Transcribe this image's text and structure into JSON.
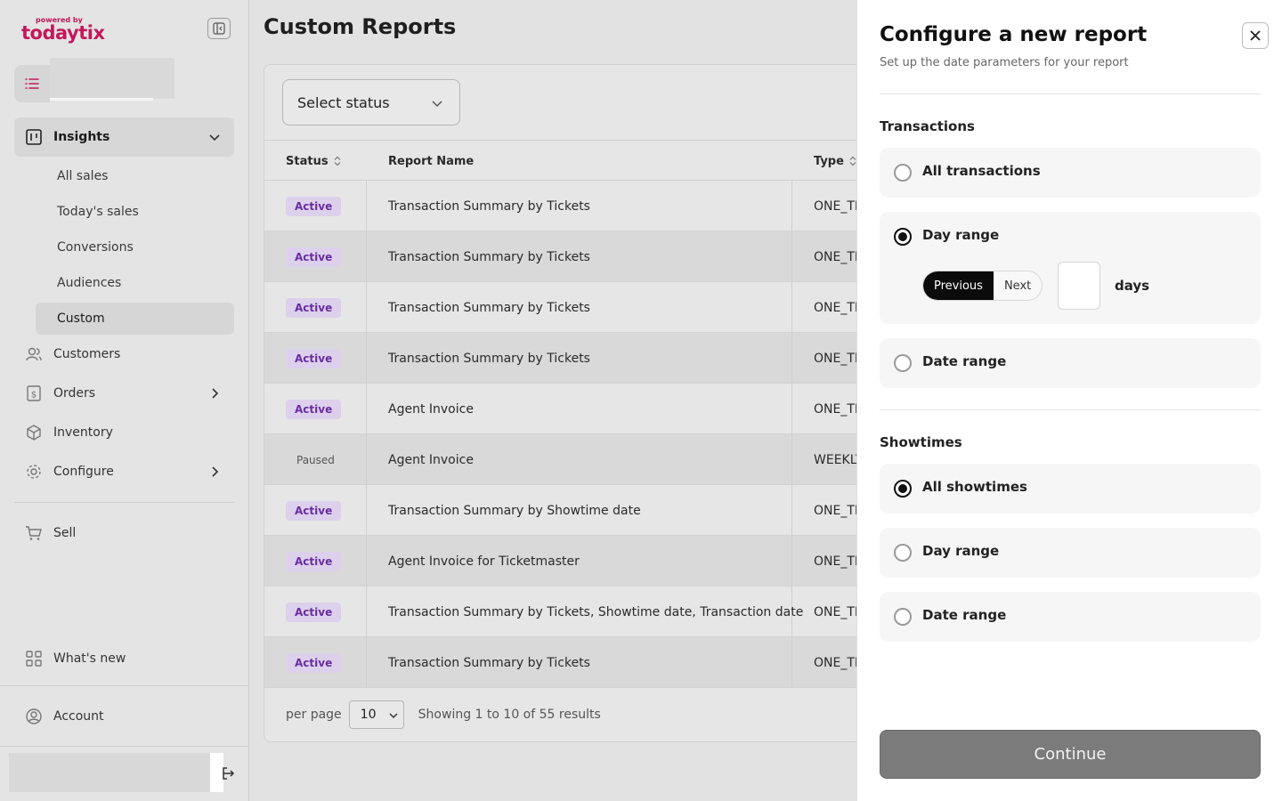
{
  "sidebar": {
    "logo_powered": "powered by",
    "logo_brand": "todaytix",
    "nav": {
      "insights": "Insights",
      "sub": [
        "All sales",
        "Today's sales",
        "Conversions",
        "Audiences",
        "Custom"
      ],
      "customers": "Customers",
      "orders": "Orders",
      "inventory": "Inventory",
      "configure": "Configure",
      "sell": "Sell",
      "whats_new": "What's new",
      "account": "Account"
    }
  },
  "main": {
    "title": "Custom Reports",
    "status_select": "Select status",
    "columns": {
      "status": "Status",
      "name": "Report Name",
      "type": "Type"
    },
    "rows": [
      {
        "status": "Active",
        "name": "Transaction Summary by Tickets",
        "type": "ONE_TI"
      },
      {
        "status": "Active",
        "name": "Transaction Summary by Tickets",
        "type": "ONE_TI"
      },
      {
        "status": "Active",
        "name": "Transaction Summary by Tickets",
        "type": "ONE_TI"
      },
      {
        "status": "Active",
        "name": "Transaction Summary by Tickets",
        "type": "ONE_TI"
      },
      {
        "status": "Active",
        "name": "Agent Invoice",
        "type": "ONE_TI"
      },
      {
        "status": "Paused",
        "name": "Agent Invoice",
        "type": "WEEKLY"
      },
      {
        "status": "Active",
        "name": "Transaction Summary by Showtime date",
        "type": "ONE_TI"
      },
      {
        "status": "Active",
        "name": "Agent Invoice for Ticketmaster",
        "type": "ONE_TI"
      },
      {
        "status": "Active",
        "name": "Transaction Summary by Tickets, Showtime date, Transaction date",
        "type": "ONE_TI"
      },
      {
        "status": "Active",
        "name": "Transaction Summary by Tickets",
        "type": "ONE_TI"
      }
    ],
    "footer": {
      "per_page_label": "per page",
      "per_page_value": "10",
      "showing": "Showing 1 to 10 of 55 results"
    }
  },
  "panel": {
    "title": "Configure a new report",
    "subtitle": "Set up the date parameters for your report",
    "transactions": {
      "label": "Transactions",
      "all": "All transactions",
      "day_range": "Day range",
      "previous": "Previous",
      "next": "Next",
      "days_value": "",
      "days_label": "days",
      "date_range": "Date range",
      "selected": "day_range"
    },
    "showtimes": {
      "label": "Showtimes",
      "all": "All showtimes",
      "day_range": "Day range",
      "date_range": "Date range",
      "selected": "all"
    },
    "continue": "Continue"
  },
  "colors": {
    "accent": "#c2185b",
    "badge_bg": "#dcd0ec",
    "badge_text": "#6a2ea0",
    "continue_bg": "#7b7b7b"
  },
  "icons": [
    "collapse-sidebar-icon",
    "list-icon",
    "insights-icon",
    "chevron-down-icon",
    "users-icon",
    "dollar-icon",
    "box-icon",
    "gear-icon",
    "chevron-right-icon",
    "cart-icon",
    "grid-icon",
    "account-icon",
    "logout-icon",
    "sort-icon",
    "close-icon"
  ]
}
